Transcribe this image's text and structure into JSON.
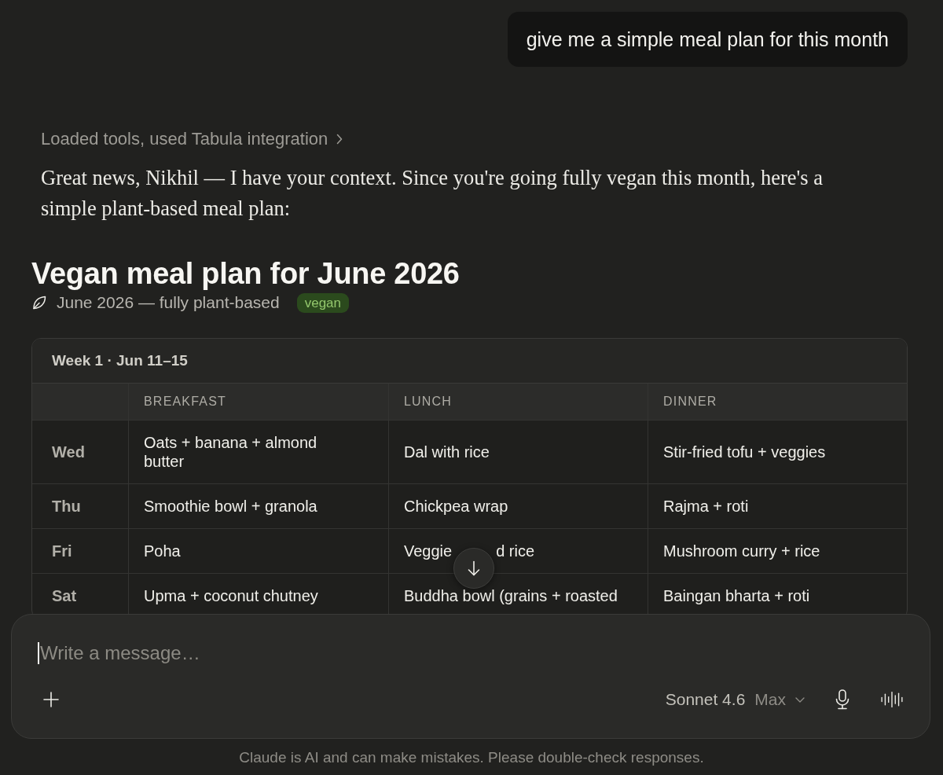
{
  "user_message": {
    "text": "give me a simple meal plan for this month"
  },
  "assistant_message": {
    "tool_summary": "Loaded tools, used Tabula integration",
    "text": "Great news, Nikhil — I have your context. Since you're going fully vegan this month, here's a simple plant-based meal plan:",
    "artifact": {
      "title": "Vegan meal plan for June 2026",
      "subtitle": "June 2026 — fully plant-based",
      "tag": "vegan",
      "table": {
        "caption": "Week 1 · Jun 11–15",
        "columns": [
          "BREAKFAST",
          "LUNCH",
          "DINNER"
        ],
        "rows": [
          {
            "day": "Wed",
            "meals": [
              [
                "Oats + banana + almond butter"
              ],
              [
                "Dal with rice"
              ],
              [
                "Stir-fried tofu + veggies"
              ]
            ]
          },
          {
            "day": "Thu",
            "meals": [
              [
                "Smoothie bowl + granola"
              ],
              [
                "Chickpea wrap"
              ],
              [
                "Rajma + roti"
              ]
            ]
          },
          {
            "day": "Fri",
            "meals": [
              [
                "Poha"
              ],
              [
                "Veggie",
                "d rice"
              ],
              [
                "Mushroom curry + rice"
              ]
            ]
          },
          {
            "day": "Sat",
            "meals": [
              [
                "Upma + coconut chutney"
              ],
              [
                "Buddha bowl (grains + roasted"
              ],
              [
                "Baingan bharta + roti"
              ]
            ]
          }
        ]
      }
    }
  },
  "composer": {
    "placeholder": "Write a message…",
    "focused": true,
    "model": "Sonnet 4.6",
    "effort": "Max"
  },
  "disclaimer": "Claude is AI and can make mistakes. Please double-check responses."
}
